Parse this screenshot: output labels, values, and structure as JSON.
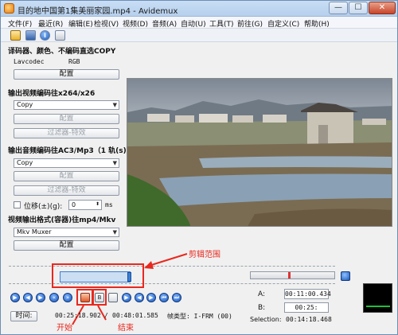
{
  "window": {
    "title": "目的地中国第1集美丽家园.mp4 - Avidemux",
    "min_glyph": "—",
    "max_glyph": "☐",
    "close_glyph": "✕"
  },
  "menu": [
    "文件(F)",
    "最近(R)",
    "编辑(E)",
    "检视(V)",
    "视频(D)",
    "音频(A)",
    "自动(U)",
    "工具(T)",
    "前往(G)",
    "自定义(C)",
    "帮助(H)"
  ],
  "toolbar": {
    "icons": [
      "open-file-icon",
      "save-icon",
      "info-icon",
      "properties-icon"
    ]
  },
  "left_panel": {
    "decoder_heading": "译码器、颜色、不编码直选COPY",
    "decoder_name": "Lavcodec",
    "decoder_color": "RGB",
    "decoder_config": "配置",
    "video_output_heading": "输出视频编码往x264/x26",
    "video_codec": "Copy",
    "video_config": "配置",
    "video_filters": "过滤器-特效",
    "audio_output_heading": "输出音频编码往AC3/Mp3（1 轨(s)）",
    "audio_codec": "Copy",
    "audio_config": "配置",
    "audio_filters": "过滤器-特效",
    "shift_label": "位移(±)(g):",
    "shift_value": "0",
    "shift_unit": "ms",
    "container_heading": "视频输出格式(容器)往mp4/Mkv",
    "container": "Mkv Muxer",
    "container_config": "配置"
  },
  "annotations": {
    "range_label": "剪辑范围",
    "start_label": "开始",
    "end_label": "结束",
    "colors": {
      "annotation": "#e8281e"
    }
  },
  "status": {
    "time_button": "时间:",
    "current_time": "00:25:18.902",
    "separator": "/",
    "total_time": "00:48:01.585",
    "frame_type": "帧类型: I-FRM (00)",
    "a_label": "A:",
    "a_time": "00:11:00.434",
    "b_label": "B:",
    "b_time": "00:25:",
    "selection_label": "Selection:",
    "selection_time": "00:14:18.468"
  }
}
